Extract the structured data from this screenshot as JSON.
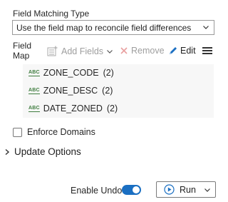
{
  "field_matching": {
    "label": "Field Matching Type",
    "selected": "Use the field map to reconcile field differences"
  },
  "field_map": {
    "label": "Field Map",
    "toolbar": {
      "add_fields": "Add Fields",
      "remove": "Remove",
      "edit": "Edit"
    },
    "fields": [
      {
        "type": "ABC",
        "name": "ZONE_CODE",
        "count": "(2)"
      },
      {
        "type": "ABC",
        "name": "ZONE_DESC",
        "count": "(2)"
      },
      {
        "type": "ABC",
        "name": "DATE_ZONED",
        "count": "(2)"
      }
    ]
  },
  "enforce_domains": {
    "label": "Enforce Domains",
    "checked": false
  },
  "update_options": {
    "label": "Update Options"
  },
  "footer": {
    "enable_undo": "Enable Undo",
    "undo_on": true,
    "run": "Run"
  },
  "colors": {
    "accent": "#1a6fc2",
    "field_type": "#3f7d3f",
    "disabled": "#9e9e9e",
    "remove_x": "#e06c6c"
  }
}
